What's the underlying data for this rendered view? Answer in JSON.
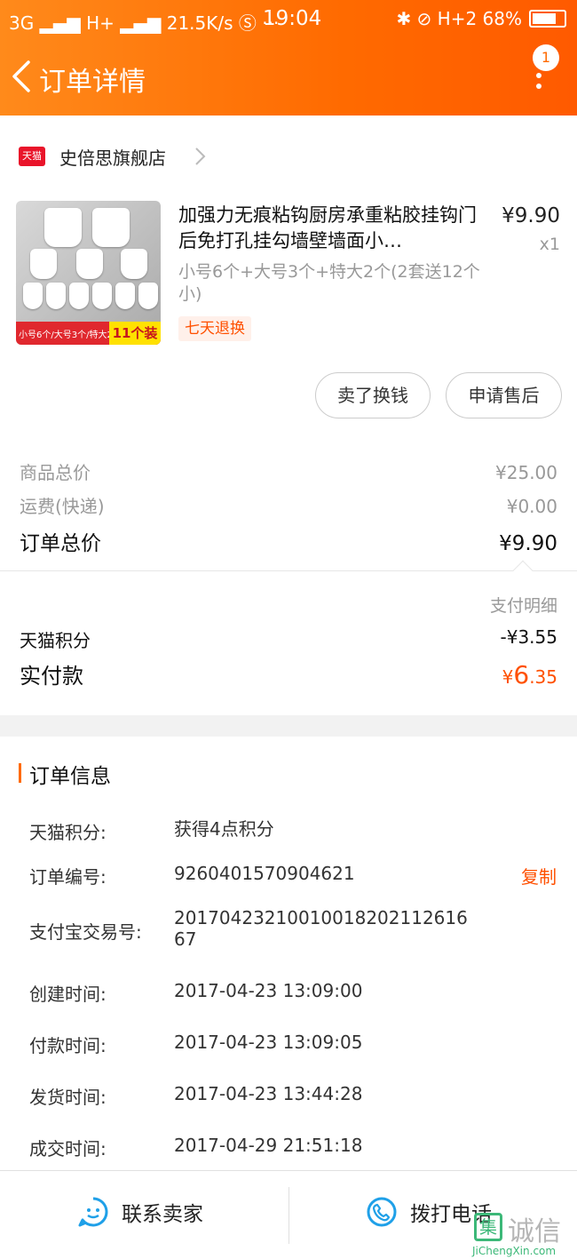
{
  "status_bar": {
    "left": "3G ▂▄▆ H+ ▂▄▆ 21.5K/s Ⓢ ···",
    "time": "19:04",
    "right": "✱ ⊘ H+2 68%"
  },
  "nav": {
    "title": "订单详情",
    "badge": "1"
  },
  "shop": {
    "logo": "天猫",
    "name": "史倍思旗舰店"
  },
  "product": {
    "title": "加强力无痕粘钩厨房承重粘胶挂钩门后免打孔挂勾墙壁墙面小…",
    "price": "¥9.90",
    "qty": "x1",
    "sku": "小号6个+大号3个+特大2个(2套送12个小)",
    "tag": "七天退换",
    "thumb_text": "小号6个/大号3个/特大2个",
    "thumb_count": "11个装"
  },
  "actions": {
    "sell": "卖了换钱",
    "after_sale": "申请售后"
  },
  "summary": {
    "goods_label": "商品总价",
    "goods_value": "¥25.00",
    "ship_label": "运费(快递)",
    "ship_value": "¥0.00",
    "total_label": "订单总价",
    "total_value": "¥9.90"
  },
  "payment": {
    "detail_label": "支付明细",
    "points_label": "天猫积分",
    "points_value": "-¥3.55",
    "paid_label": "实付款",
    "paid_symbol": "¥",
    "paid_int": "6",
    "paid_dec": ".35"
  },
  "order_info": {
    "title": "订单信息",
    "rows": [
      {
        "label": "天猫积分:",
        "value": "获得4点积分"
      },
      {
        "label": "订单编号:",
        "value": "9260401570904621"
      },
      {
        "label": "支付宝交易号:",
        "value": "2017042321001001820211261667"
      },
      {
        "label": "创建时间:",
        "value": "2017-04-23 13:09:00"
      },
      {
        "label": "付款时间:",
        "value": "2017-04-23 13:09:05"
      },
      {
        "label": "发货时间:",
        "value": "2017-04-23 13:44:28"
      },
      {
        "label": "成交时间:",
        "value": "2017-04-29 21:51:18"
      }
    ],
    "copy_label": "复制"
  },
  "bottom": {
    "contact": "联系卖家",
    "call": "拨打电话"
  },
  "watermark": {
    "box": "集",
    "text": "诚信",
    "url": "JiChengXin.com"
  },
  "colors": {
    "accent": "#ff6a00",
    "price_orange": "#ff5000",
    "tmall_red": "#e9142a"
  }
}
